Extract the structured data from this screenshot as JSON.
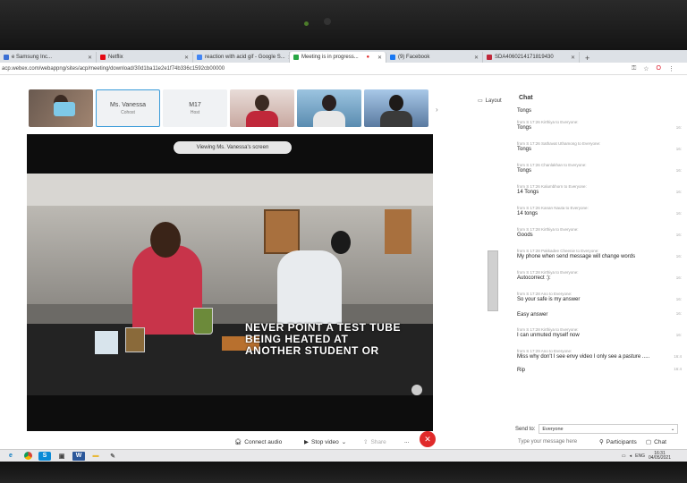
{
  "tabs": [
    {
      "label": "e Samsung Inc...",
      "fav_color": "#3b6fd4"
    },
    {
      "label": "Netflix",
      "fav_color": "#e50914"
    },
    {
      "label": "reaction with acid gif - Google S...",
      "fav_color": "#4285f4"
    },
    {
      "label": "Meeting is in progress...",
      "fav_color": "#28a745",
      "active": true
    },
    {
      "label": "(9) Facebook",
      "fav_color": "#1877f2"
    },
    {
      "label": "SDA4060214171819430",
      "fav_color": "#c0283a"
    }
  ],
  "new_tab": "+",
  "address": {
    "url": "acp.webex.com/webappng/sites/acp/meeting/download/30d1ba11e2e1f74b336c1592cb00000"
  },
  "participants": [
    {
      "type": "video",
      "style": "p1"
    },
    {
      "type": "tile",
      "name": "Ms. Vanessa",
      "sub": "Cohost",
      "selected": true
    },
    {
      "type": "tile",
      "name": "M17",
      "sub": "Host"
    },
    {
      "type": "video",
      "style": "p2"
    },
    {
      "type": "video",
      "style": "p3"
    },
    {
      "type": "video",
      "style": "p4"
    }
  ],
  "layout_label": "Layout",
  "stage": {
    "viewing_label": "Viewing Ms. Vanessa's screen",
    "caption_lines": [
      "NEVER POINT A TEST TUBE",
      "BEING HEATED AT",
      "ANOTHER STUDENT OR"
    ]
  },
  "chat": {
    "title": "Chat",
    "messages": [
      {
        "meta": "",
        "text": "Tongs",
        "time": ""
      },
      {
        "meta": "from S 17:26 Kirthiya to Everyone:",
        "text": "Tongs",
        "time": "16:"
      },
      {
        "meta": "from S 17:26 Sathavat Uthamong to Everyone:",
        "text": "Tongs",
        "time": "16:"
      },
      {
        "meta": "from S 17:26 Chanlakhan to Everyone:",
        "text": "Tongs",
        "time": "16:"
      },
      {
        "meta": "from S 17:26 Kalumbhorn to Everyone:",
        "text": "14 Tongs",
        "time": "16:"
      },
      {
        "meta": "from S 17:26 Kanan Nauta to Everyone:",
        "text": "14 tongs",
        "time": "16:"
      },
      {
        "meta": "from S 17:28 Kirthiya to Everyone:",
        "text": "Goods",
        "time": "16:"
      },
      {
        "meta": "from S 17:28 Pakkadee Cheenie to Everyone:",
        "text": "My phone when send message will change words",
        "time": "16:"
      },
      {
        "meta": "from S 17:28 Kirthiya to Everyone:",
        "text": "Autocorrect :):",
        "time": "16:"
      },
      {
        "meta": "from S 17:28 Ano to Everyone:",
        "text": "So your safe is my answer",
        "time": "16:"
      },
      {
        "meta": "",
        "text": "Easy answer",
        "time": "16:"
      },
      {
        "meta": "from S 17:28 Kirthiya to Everyone:",
        "text": "I can unmuted myself now",
        "time": "16:"
      },
      {
        "meta": "from S 17:29 Ano to Everyone:",
        "text": "Miss why don't I see envy video I only see a pasture .....",
        "time": "16:4"
      },
      {
        "meta": "",
        "text": "Rip",
        "time": "16:4"
      }
    ],
    "send_to_label": "Send to:",
    "send_to_value": "Everyone",
    "input_placeholder": "Type your message here"
  },
  "controls": {
    "connect_audio": "Connect audio",
    "stop_video": "Stop video",
    "share": "Share",
    "more": "...",
    "end": "✕",
    "participants": "Participants",
    "chat": "Chat"
  },
  "taskbar": {
    "lang": "ENG",
    "time": "16:31",
    "date": "04/05/2021"
  }
}
